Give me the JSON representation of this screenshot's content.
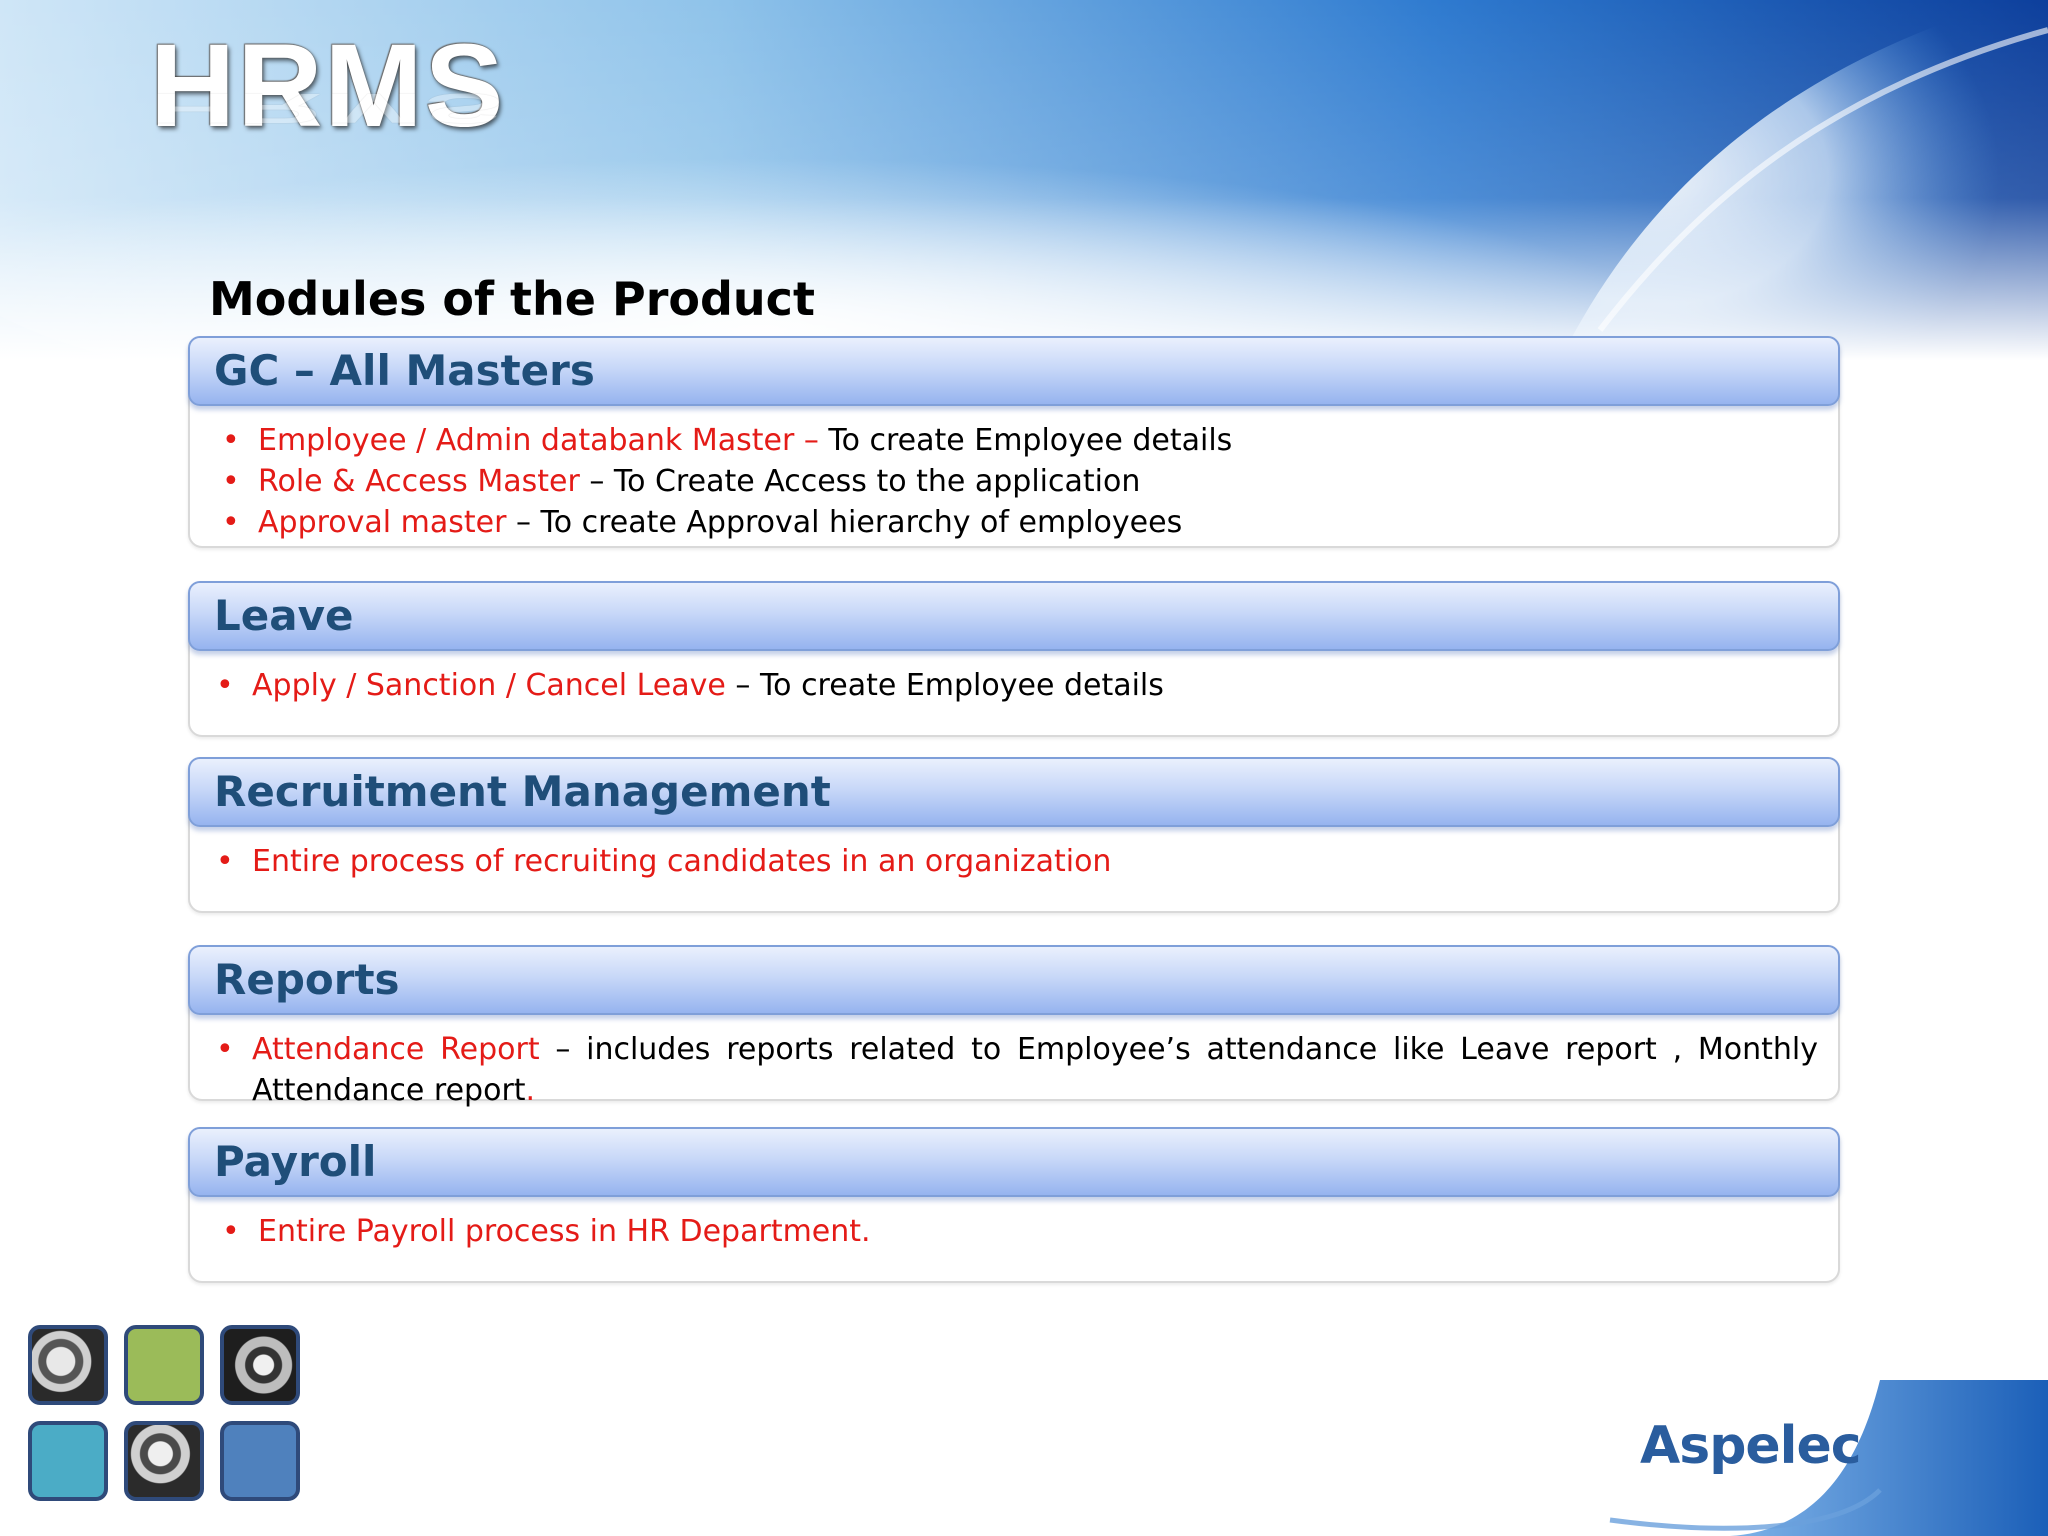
{
  "header": {
    "logo_text": "HRMS",
    "section_title": "Modules of the Product"
  },
  "modules": [
    {
      "title": "GC – All Masters",
      "items": [
        {
          "highlight": "Employee / Admin databank Master – ",
          "rest": "To create Employee details"
        },
        {
          "highlight": "Role & Access Master",
          "rest": " – To Create Access to the application"
        },
        {
          "highlight": "Approval master",
          "rest": " – To create Approval hierarchy of employees"
        }
      ]
    },
    {
      "title": "Leave",
      "items": [
        {
          "highlight": "Apply / Sanction / Cancel Leave",
          "rest": " – To create Employee details"
        }
      ]
    },
    {
      "title": "Recruitment Management",
      "items": [
        {
          "highlight": "Entire process of recruiting candidates in an organization",
          "rest": ""
        }
      ]
    },
    {
      "title": "Reports",
      "items": [
        {
          "highlight": "Attendance Report",
          "rest": " – includes reports related to Employee’s attendance like Leave report , Monthly Attendance report",
          "tail": "."
        }
      ]
    },
    {
      "title": "Payroll",
      "items": [
        {
          "highlight": "Entire Payroll process in HR Department.",
          "rest": ""
        }
      ]
    }
  ],
  "bullet_char": "•",
  "footer": {
    "brand": "Aspelec"
  },
  "colors": {
    "accent_red": "#e41b17",
    "module_title": "#1f4e79",
    "brand_blue": "#2a5d9e"
  }
}
